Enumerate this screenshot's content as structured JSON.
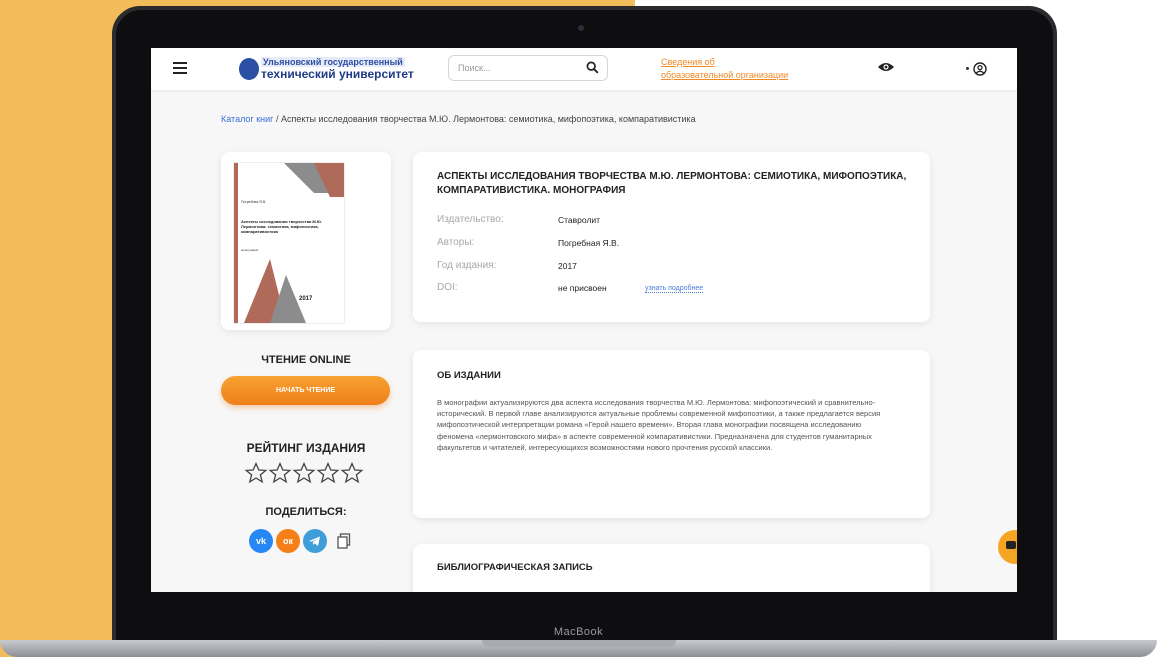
{
  "device": {
    "brand": "MacBook"
  },
  "header": {
    "logo": {
      "line1": "Ульяновский государственный",
      "line2": "технический университет"
    },
    "search_placeholder": "Поиск...",
    "info_link": [
      "Сведения об",
      "образовательной организации"
    ]
  },
  "breadcrumb": {
    "root": "Каталог книг",
    "separator": "/",
    "current": "Аспекты исследования творчества М.Ю. Лермонтова: семиотика, мифопоэтика, компаративистика"
  },
  "cover": {
    "author": "Погребная Я.В.",
    "title": "Аспекты исследования творчества М.Ю. Лермонтова: семиотика, мифопоэтика, компаративистика",
    "subtitle": "монография",
    "year": "2017"
  },
  "sidebar": {
    "read_online": "ЧТЕНИЕ ONLINE",
    "read_button": "НАЧАТЬ ЧТЕНИЕ",
    "rating_title": "РЕЙТИНГ ИЗДАНИЯ",
    "rating_value": 0,
    "rating_max": 5,
    "share_title": "ПОДЕЛИТЬСЯ:",
    "share_icons": [
      "vk-icon",
      "odnoklassniki-icon",
      "telegram-icon",
      "copy-icon"
    ]
  },
  "book": {
    "title": "АСПЕКТЫ ИССЛЕДОВАНИЯ ТВОРЧЕСТВА М.Ю. ЛЕРМОНТОВА: СЕМИОТИКА, МИФОПОЭТИКА, КОМПАРАТИВИСТИКА. МОНОГРАФИЯ",
    "publisher_label": "Издательство:",
    "publisher": "Ставролит",
    "authors_label": "Авторы:",
    "authors": "Погребная Я.В.",
    "year_label": "Год издания:",
    "year": "2017",
    "doi_label": "DOI:",
    "doi": "не присвоен",
    "doi_link": "узнать подробнее"
  },
  "about": {
    "title": "ОБ ИЗДАНИИ",
    "text": "В монографии актуализируются два аспекта исследования творчества М.Ю. Лермонтова: мифопоэтический и сравнительно-исторический. В первой главе анализируются актуальные проблемы современной мифопоэтики, а также предлагается версия мифопоэтической интерпретации романа «Герой нашего времени». Вторая глава монографии посвящена исследованию феномена «лермонтовского мифа» в аспекте современной компаративистики. Предназначена для студентов гуманитарных факультетов и читателей, интересующихся возможностями нового прочтения русской классики."
  },
  "bibliography": {
    "title": "БИБЛИОГРАФИЧЕСКАЯ ЗАПИСЬ"
  },
  "colors": {
    "accent": "#f08a24",
    "background_left": "#f2bc5b",
    "link": "#3a6fd8"
  }
}
